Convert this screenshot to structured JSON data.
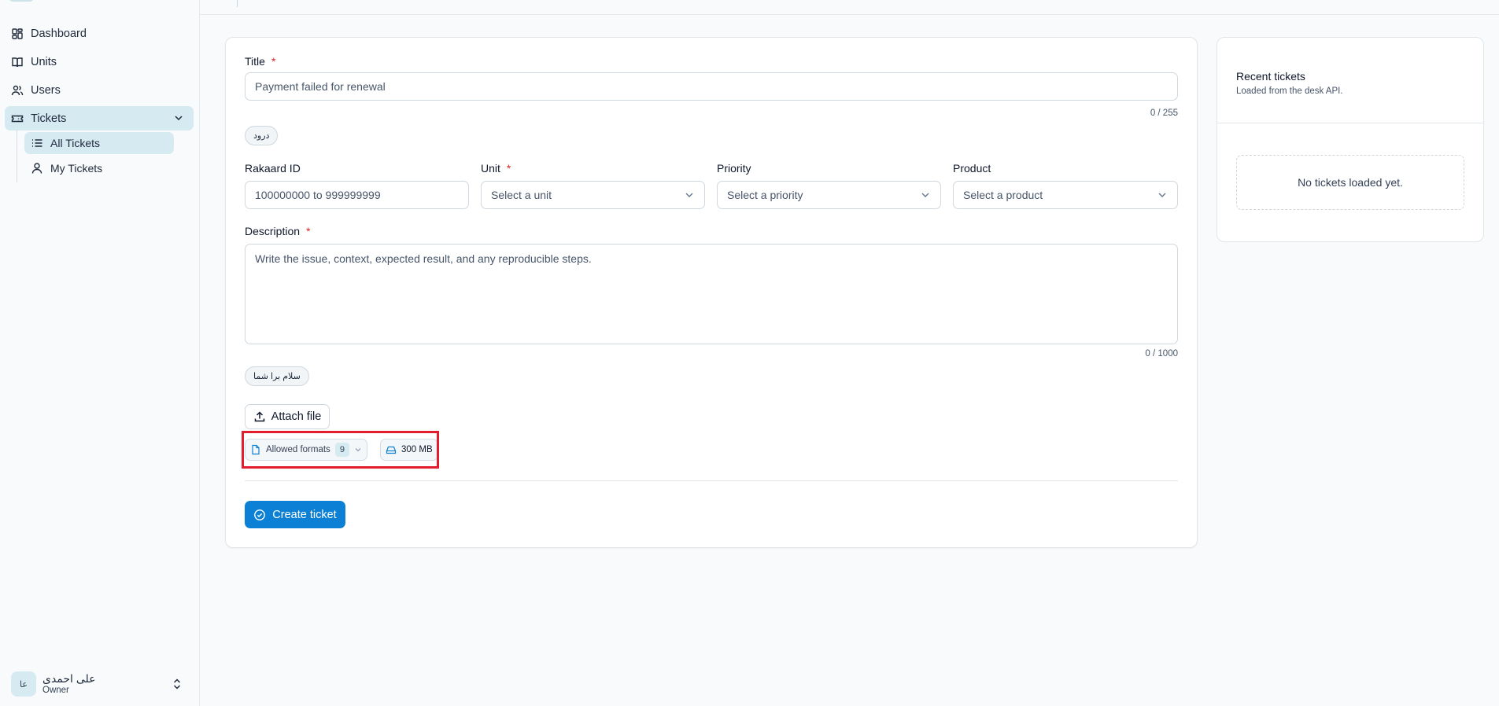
{
  "sidebar": {
    "items": [
      {
        "label": "Dashboard",
        "icon": "dashboard-icon"
      },
      {
        "label": "Units",
        "icon": "book-icon"
      },
      {
        "label": "Users",
        "icon": "users-icon"
      },
      {
        "label": "Tickets",
        "icon": "ticket-icon"
      }
    ],
    "sub_items": [
      {
        "label": "All Tickets",
        "icon": "list-icon"
      },
      {
        "label": "My Tickets",
        "icon": "user-icon"
      }
    ],
    "user": {
      "initials": "عا",
      "name": "علی احمدی",
      "role": "Owner"
    }
  },
  "form": {
    "title_label": "Title",
    "title_value": "Payment failed for renewal",
    "title_counter": "0 / 255",
    "title_chip": "درود",
    "rakaard_label": "Rakaard ID",
    "rakaard_placeholder": "100000000 to 999999999",
    "unit_label": "Unit",
    "unit_placeholder": "Select a unit",
    "priority_label": "Priority",
    "priority_placeholder": "Select a priority",
    "product_label": "Product",
    "product_placeholder": "Select a product",
    "description_label": "Description",
    "description_placeholder": "Write the issue, context, expected result, and any reproducible steps.",
    "description_counter": "0 / 1000",
    "description_chip": "سلام برا شما",
    "attach_label": "Attach file",
    "allowed_formats_label": "Allowed formats",
    "allowed_formats_count": "9",
    "max_size": "300 MB",
    "submit_label": "Create ticket",
    "required_mark": "*"
  },
  "recent": {
    "title": "Recent tickets",
    "subtitle": "Loaded from the desk API.",
    "empty": "No tickets loaded yet."
  },
  "colors": {
    "primary": "#0b80d4",
    "active_bg": "#d6eaf2",
    "required": "#dc2626",
    "highlight": "#e11d2e"
  }
}
